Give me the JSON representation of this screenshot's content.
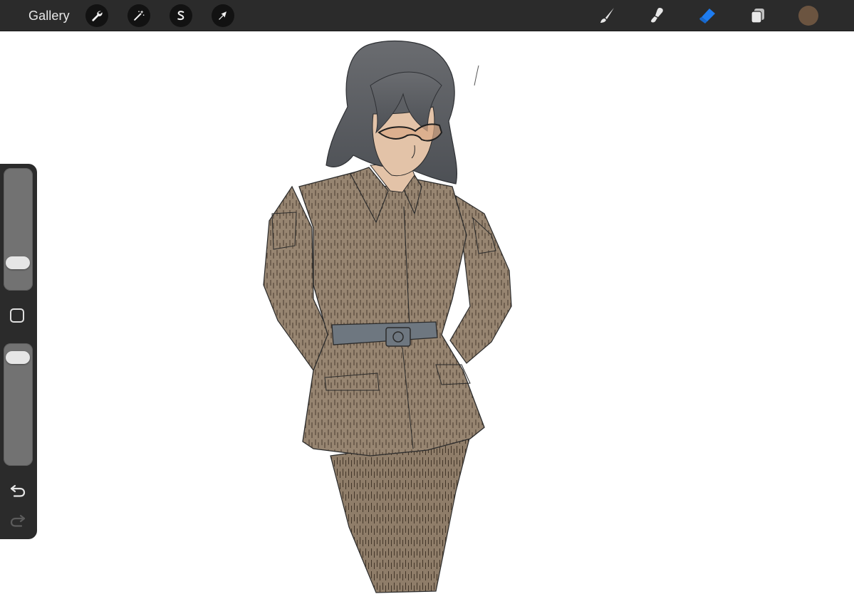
{
  "topbar": {
    "gallery_label": "Gallery",
    "left_tools": [
      {
        "icon": "wrench-icon",
        "name": "actions"
      },
      {
        "icon": "magic-wand-icon",
        "name": "adjustments"
      },
      {
        "icon": "selection-s-icon",
        "name": "selection"
      },
      {
        "icon": "transform-arrow-icon",
        "name": "transform"
      }
    ],
    "right_tools": [
      {
        "icon": "brush-icon",
        "name": "paint",
        "active": false
      },
      {
        "icon": "smudge-icon",
        "name": "smudge",
        "active": false
      },
      {
        "icon": "eraser-icon",
        "name": "erase",
        "active": true
      },
      {
        "icon": "layers-icon",
        "name": "layers",
        "active": false
      }
    ],
    "current_color": "#6b5440",
    "active_tool_color": "#1e7cf0"
  },
  "sidebar": {
    "brush_size_level": 0.18,
    "opacity_level": 0.95,
    "undo_icon": "undo-arrow-icon",
    "redo_icon": "redo-arrow-icon",
    "redo_enabled": false
  },
  "canvas": {
    "subject": "drawing",
    "palette": {
      "hair": "#5a5d62",
      "skin": "#e3c3a8",
      "jacket": "#978571",
      "belt": "#6e7780"
    }
  }
}
